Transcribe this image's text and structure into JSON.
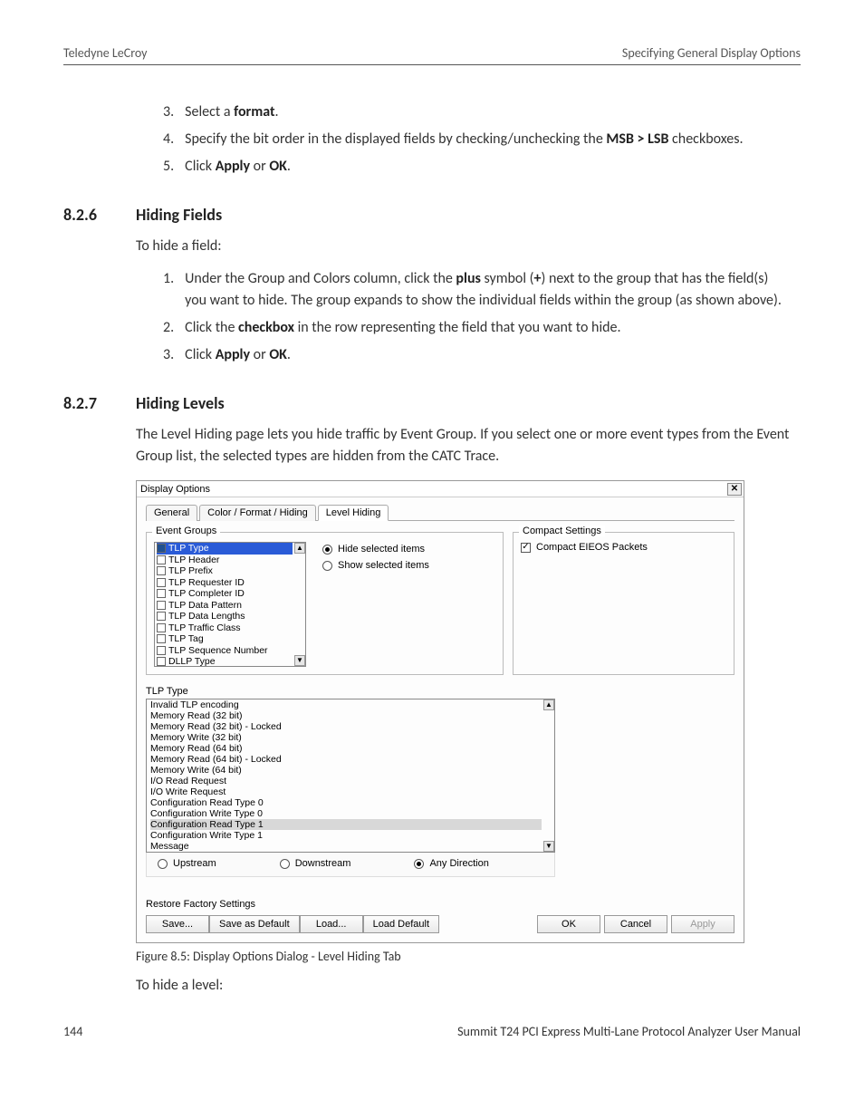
{
  "header": {
    "left": "Teledyne LeCroy",
    "right": "Specifying General Display Options"
  },
  "steps_top": [
    {
      "num": "3.",
      "html": "Select a <b>format</b>."
    },
    {
      "num": "4.",
      "html": "Specify the bit order in the displayed fields by checking/unchecking the <b>MSB > LSB</b> checkboxes."
    },
    {
      "num": "5.",
      "html": "Click <b>Apply</b> or <b>OK</b>."
    }
  ],
  "sec826": {
    "num": "8.2.6",
    "title": "Hiding Fields",
    "intro": "To hide a field:"
  },
  "steps_826": [
    {
      "num": "1.",
      "html": "Under the Group and Colors column, click the <b>plus</b> symbol (<b>+</b>) next to the group that has the field(s) you want to hide. The group expands to show the individual fields within the group (as shown above)."
    },
    {
      "num": "2.",
      "html": "Click the <b>checkbox</b> in the row representing the field that you want to hide."
    },
    {
      "num": "3.",
      "html": "Click <b>Apply</b> or <b>OK</b>."
    }
  ],
  "sec827": {
    "num": "8.2.7",
    "title": "Hiding Levels",
    "intro": "The Level Hiding page lets you hide traffic by Event Group. If you select one or more event types from the Event Group list, the selected types are hidden from the CATC Trace."
  },
  "dialog": {
    "title": "Display Options",
    "tabs": [
      "General",
      "Color / Format / Hiding",
      "Level Hiding"
    ],
    "active_tab": 2,
    "event_groups_label": "Event Groups",
    "event_groups": [
      {
        "label": "TLP Type",
        "checked": true,
        "selected": true
      },
      {
        "label": "TLP Header",
        "checked": false
      },
      {
        "label": "TLP Prefix",
        "checked": false
      },
      {
        "label": "TLP Requester ID",
        "checked": false
      },
      {
        "label": "TLP Completer ID",
        "checked": false
      },
      {
        "label": "TLP Data Pattern",
        "checked": false
      },
      {
        "label": "TLP Data Lengths",
        "checked": false
      },
      {
        "label": "TLP Traffic Class",
        "checked": false
      },
      {
        "label": "TLP Tag",
        "checked": false
      },
      {
        "label": "TLP Sequence Number",
        "checked": false
      },
      {
        "label": "DLLP Type",
        "checked": false
      }
    ],
    "radio_hide": "Hide selected items",
    "radio_show": "Show selected items",
    "compact_label": "Compact Settings",
    "compact_check": "Compact EIEOS Packets",
    "tlp_type_label": "TLP Type",
    "tlp_items": [
      "Invalid TLP encoding",
      "Memory Read (32 bit)",
      "Memory Read (32 bit) - Locked",
      "Memory Write (32 bit)",
      "Memory Read (64 bit)",
      "Memory Read (64 bit) - Locked",
      "Memory Write (64 bit)",
      "I/O Read Request",
      "I/O Write Request",
      "Configuration Read Type 0",
      "Configuration Write Type 0",
      "Configuration Read Type 1",
      "Configuration Write Type 1",
      "Message"
    ],
    "tlp_selected_index": 11,
    "dir": {
      "upstream": "Upstream",
      "downstream": "Downstream",
      "any": "Any Direction"
    },
    "restore": "Restore Factory Settings",
    "buttons_left": [
      "Save...",
      "Save as Default",
      "Load...",
      "Load Default"
    ],
    "buttons_right": [
      "OK",
      "Cancel",
      "Apply"
    ]
  },
  "figure_caption": "Figure 8.5:  Display Options Dialog - Level Hiding Tab",
  "outro": "To hide a level:",
  "footer": {
    "page": "144",
    "manual": "Summit T24 PCI Express Multi-Lane Protocol Analyzer User Manual"
  }
}
